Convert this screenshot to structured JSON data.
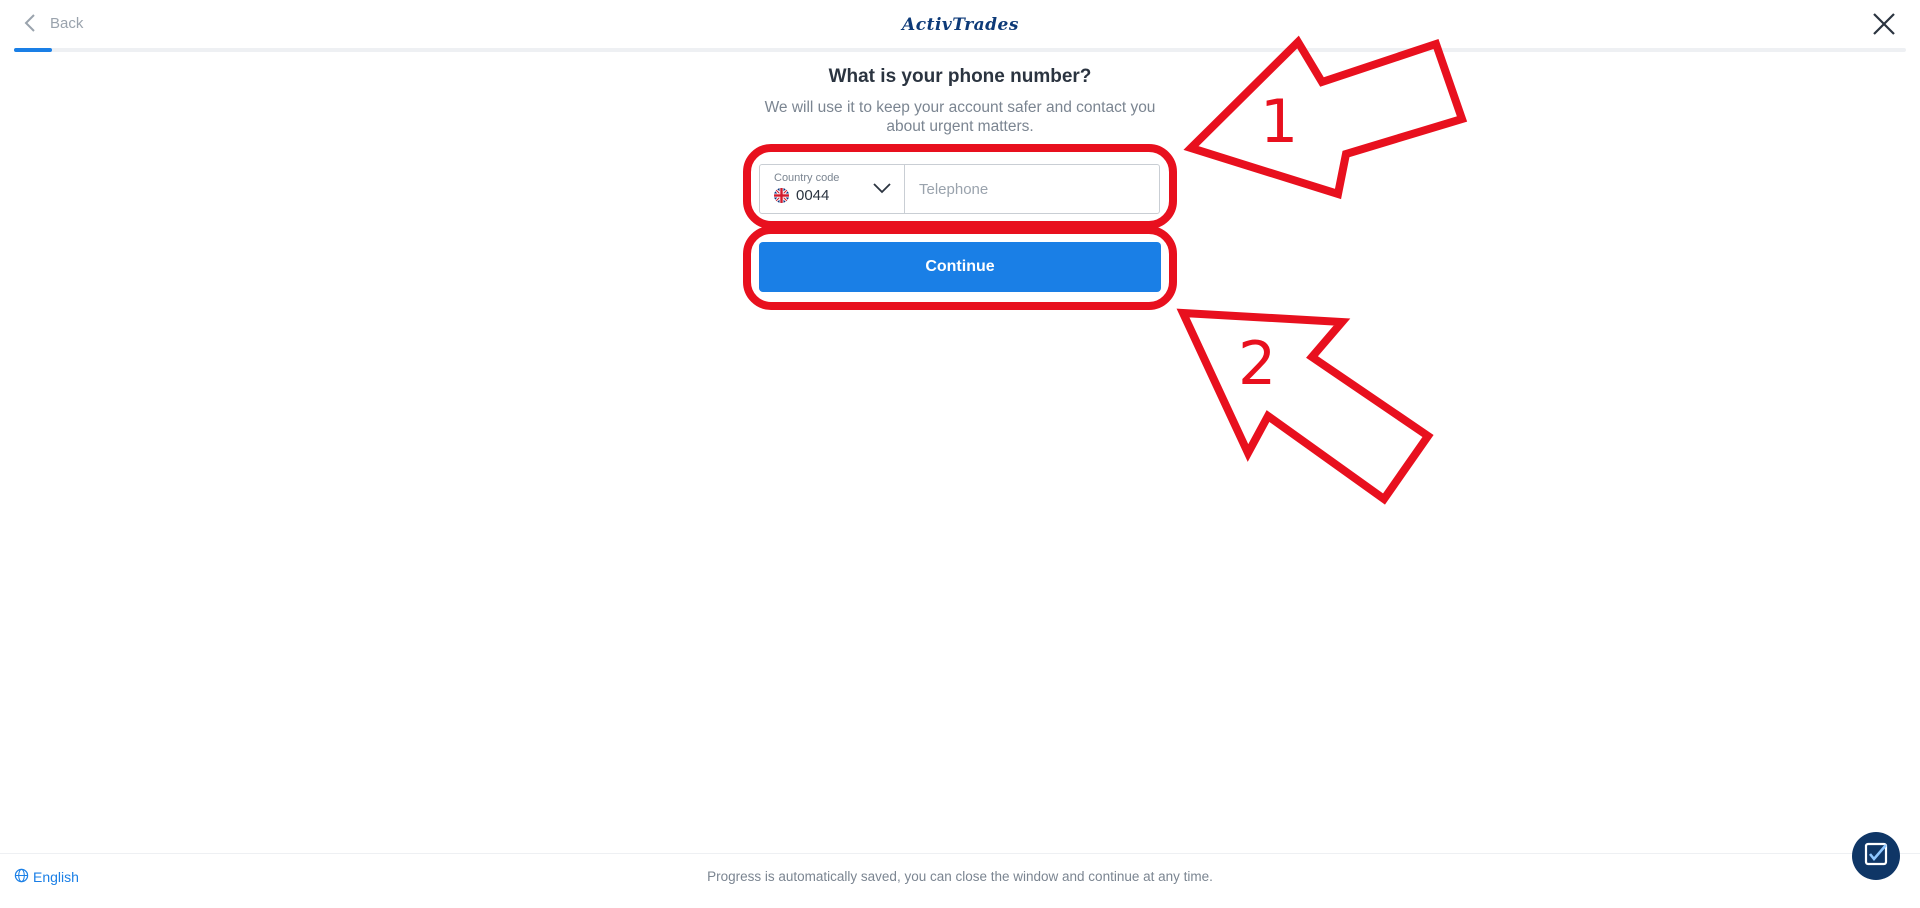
{
  "header": {
    "back_label": "Back",
    "brand": "ActivTrades",
    "progress_fraction": 0.02,
    "colors": {
      "accent": "#1a7fe6",
      "brand": "#0d3a78"
    }
  },
  "form": {
    "title": "What is your phone number?",
    "subtitle_line1": "We will use it to keep your account safer and contact you",
    "subtitle_line2": "about urgent matters.",
    "country_code": {
      "label": "Country code",
      "flag_icon": "uk-flag-icon",
      "value": "0044"
    },
    "telephone": {
      "placeholder": "Telephone",
      "value": ""
    },
    "continue_label": "Continue"
  },
  "annotations": {
    "color": "#e8101e",
    "step1": "1",
    "step2": "2"
  },
  "footer": {
    "language": "English",
    "note": "Progress is automatically saved, you can close the window and continue at any time."
  },
  "icons": {
    "back": "chevron-left-icon",
    "close": "close-icon",
    "dropdown": "chevron-down-icon",
    "language": "globe-icon",
    "chat": "chat-checkbox-icon"
  }
}
